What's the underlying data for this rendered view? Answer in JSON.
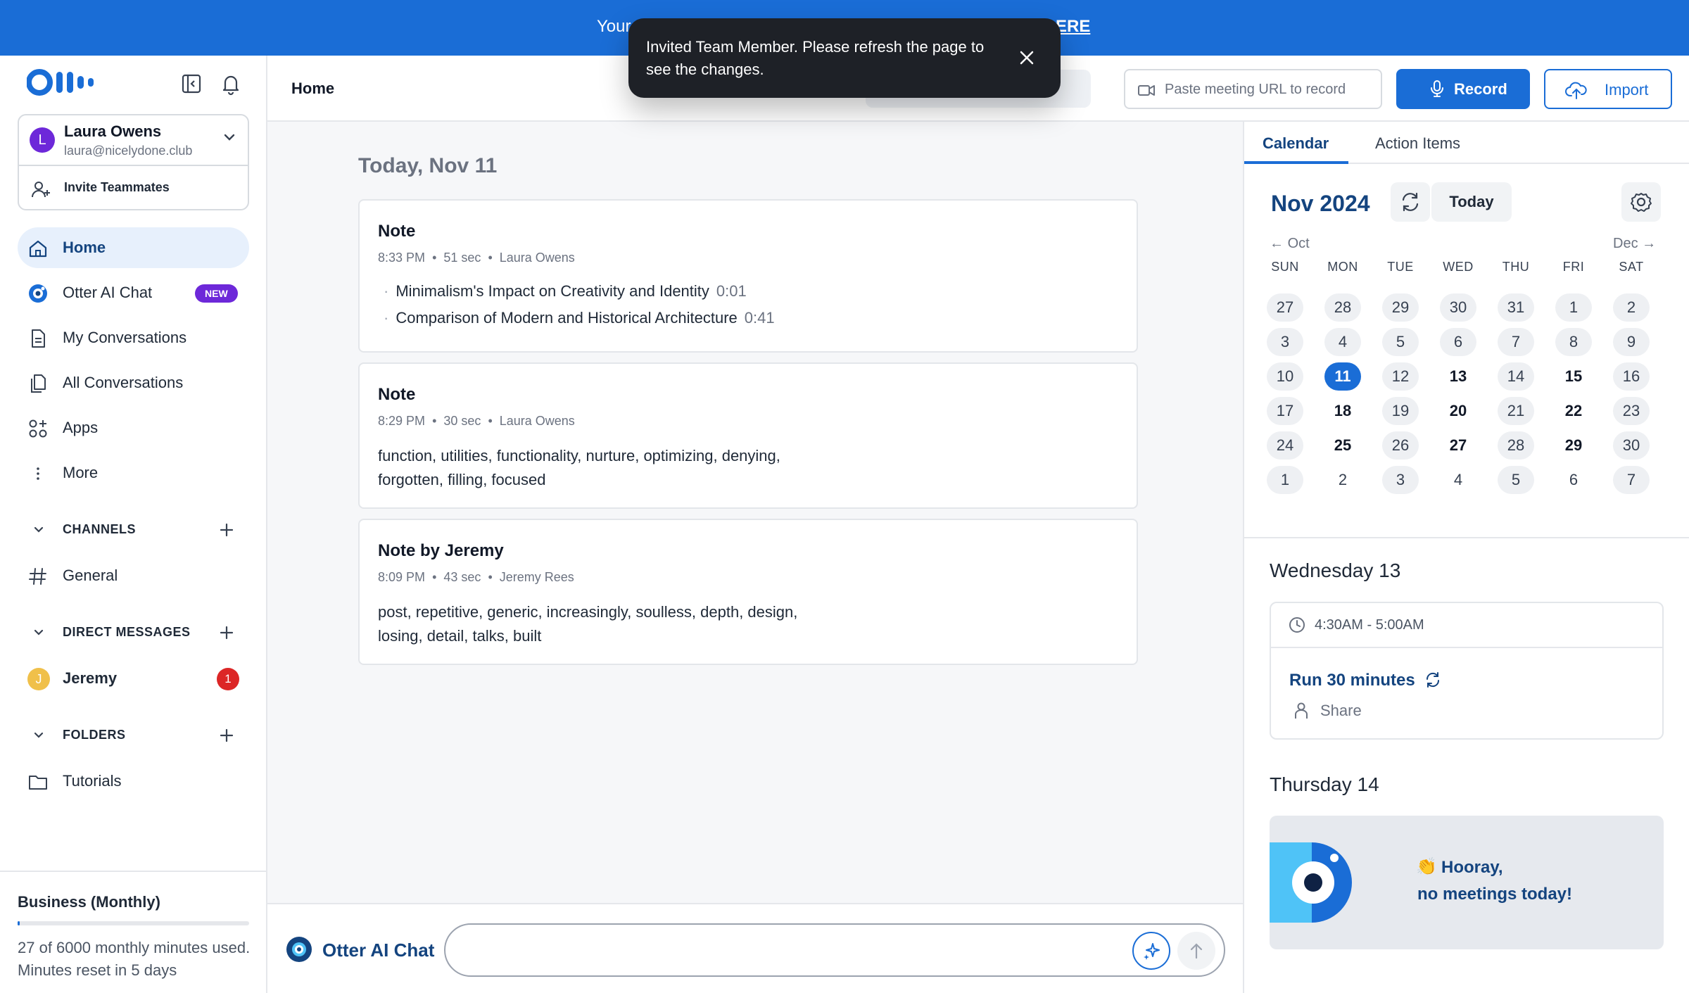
{
  "banner": {
    "left_text": "Your",
    "right_text": "ERE"
  },
  "toast": {
    "message": "Invited Team Member. Please refresh the page to see the changes."
  },
  "account": {
    "initial": "L",
    "name": "Laura Owens",
    "email": "laura@nicelydone.club",
    "invite_label": "Invite Teammates"
  },
  "nav": {
    "items": [
      {
        "label": "Home",
        "icon": "home-icon"
      },
      {
        "label": "Otter AI Chat",
        "icon": "otter-chat-icon",
        "badge": "NEW"
      },
      {
        "label": "My Conversations",
        "icon": "document-icon"
      },
      {
        "label": "All Conversations",
        "icon": "documents-icon"
      },
      {
        "label": "Apps",
        "icon": "apps-icon"
      },
      {
        "label": "More",
        "icon": "more-vertical-icon"
      }
    ]
  },
  "channels": {
    "heading": "CHANNELS",
    "items": [
      {
        "label": "General"
      }
    ]
  },
  "direct_messages": {
    "heading": "DIRECT MESSAGES",
    "items": [
      {
        "initial": "J",
        "label": "Jeremy",
        "count": "1"
      }
    ]
  },
  "folders": {
    "heading": "FOLDERS",
    "items": [
      {
        "label": "Tutorials"
      }
    ]
  },
  "plan": {
    "title": "Business (Monthly)",
    "usage_text": "27 of 6000 monthly minutes used. Minutes reset in 5 days",
    "used_minutes": 27,
    "total_minutes": 6000
  },
  "header": {
    "title": "Home",
    "url_placeholder": "Paste meeting URL to record",
    "record_label": "Record",
    "import_label": "Import"
  },
  "main": {
    "date_heading": "Today, Nov 11",
    "notes": [
      {
        "title": "Note",
        "time": "8:33 PM",
        "duration": "51 sec",
        "author": "Laura Owens",
        "bullets": [
          {
            "text": "Minimalism's Impact on Creativity and Identity",
            "ts": "0:01"
          },
          {
            "text": "Comparison of Modern and Historical Architecture",
            "ts": "0:41"
          }
        ]
      },
      {
        "title": "Note",
        "time": "8:29 PM",
        "duration": "30 sec",
        "author": "Laura Owens",
        "body": "function, utilities, functionality, nurture, optimizing, denying, forgotten, filling, focused"
      },
      {
        "title": "Note by Jeremy",
        "time": "8:09 PM",
        "duration": "43 sec",
        "author": "Jeremy Rees",
        "body": "post, repetitive, generic, increasingly, soulless, depth, design, losing, detail, talks, built"
      }
    ]
  },
  "chat": {
    "label": "Otter AI Chat",
    "placeholder": ""
  },
  "calendar": {
    "tabs": [
      "Calendar",
      "Action Items"
    ],
    "month": "Nov 2024",
    "today_label": "Today",
    "prev_label": "Oct",
    "next_label": "Dec",
    "weekdays": [
      "SUN",
      "MON",
      "TUE",
      "WED",
      "THU",
      "FRI",
      "SAT"
    ],
    "weeks": [
      [
        {
          "d": "27",
          "s": "pill"
        },
        {
          "d": "28",
          "s": "pill"
        },
        {
          "d": "29",
          "s": "pill"
        },
        {
          "d": "30",
          "s": "pill"
        },
        {
          "d": "31",
          "s": "pill"
        },
        {
          "d": "1",
          "s": "pill"
        },
        {
          "d": "2",
          "s": "pill"
        }
      ],
      [
        {
          "d": "3",
          "s": "pill"
        },
        {
          "d": "4",
          "s": "pill"
        },
        {
          "d": "5",
          "s": "pill"
        },
        {
          "d": "6",
          "s": "pill"
        },
        {
          "d": "7",
          "s": "pill"
        },
        {
          "d": "8",
          "s": "pill"
        },
        {
          "d": "9",
          "s": "pill"
        }
      ],
      [
        {
          "d": "10",
          "s": "pill"
        },
        {
          "d": "11",
          "s": "sel"
        },
        {
          "d": "12",
          "s": "pill"
        },
        {
          "d": "13",
          "s": "bold"
        },
        {
          "d": "14",
          "s": "pill"
        },
        {
          "d": "15",
          "s": "bold"
        },
        {
          "d": "16",
          "s": "pill"
        }
      ],
      [
        {
          "d": "17",
          "s": "pill"
        },
        {
          "d": "18",
          "s": "bold"
        },
        {
          "d": "19",
          "s": "pill"
        },
        {
          "d": "20",
          "s": "bold"
        },
        {
          "d": "21",
          "s": "pill"
        },
        {
          "d": "22",
          "s": "bold"
        },
        {
          "d": "23",
          "s": "pill"
        }
      ],
      [
        {
          "d": "24",
          "s": "pill"
        },
        {
          "d": "25",
          "s": "bold"
        },
        {
          "d": "26",
          "s": "pill"
        },
        {
          "d": "27",
          "s": "bold"
        },
        {
          "d": "28",
          "s": "pill"
        },
        {
          "d": "29",
          "s": "bold"
        },
        {
          "d": "30",
          "s": "pill"
        }
      ],
      [
        {
          "d": "1",
          "s": "pill"
        },
        {
          "d": "2",
          "s": ""
        },
        {
          "d": "3",
          "s": "pill"
        },
        {
          "d": "4",
          "s": ""
        },
        {
          "d": "5",
          "s": "pill"
        },
        {
          "d": "6",
          "s": ""
        },
        {
          "d": "7",
          "s": "pill"
        }
      ]
    ]
  },
  "schedule": {
    "day1": {
      "heading": "Wednesday 13",
      "event_time": "4:30AM - 5:00AM",
      "event_title": "Run 30 minutes",
      "share_label": "Share"
    },
    "day2": {
      "heading": "Thursday 14",
      "no_meetings_emoji": "👏",
      "no_meetings_line1": "Hooray,",
      "no_meetings_line2": "no meetings today!"
    }
  },
  "colors": {
    "brand_blue": "#1a6dd6",
    "navy": "#14447f",
    "badge_purple": "#6d28d9",
    "alert_red": "#dc2626"
  }
}
